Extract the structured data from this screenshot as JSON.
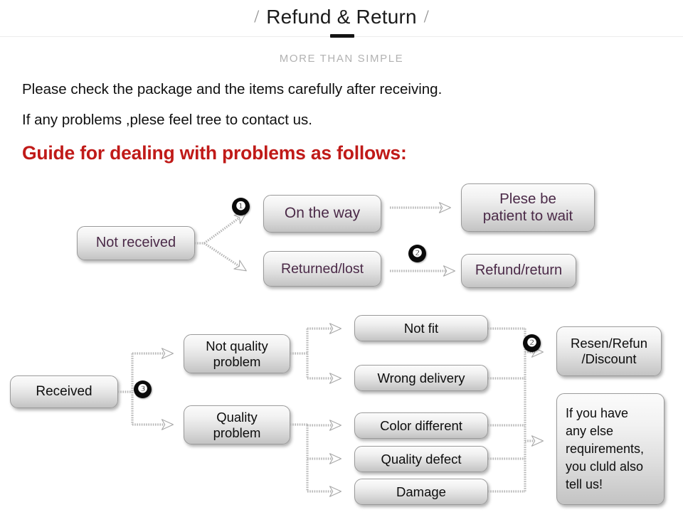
{
  "header": {
    "slash_left": "/",
    "title": "Refund & Return",
    "slash_right": "/",
    "subtitle": "MORE THAN SIMPLE",
    "accent_color": "#141414"
  },
  "intro": {
    "line1": "Please check the package and the items carefully after receiving.",
    "line2": "If any problems ,plese feel tree to contact us.",
    "guide_heading": "Guide for dealing with problems as follows:",
    "guide_color": "#c01a18"
  },
  "flow_not_received": {
    "source": "Not received",
    "badge_1": "❶",
    "badge_2": "❷",
    "branches": [
      {
        "cause": "On the way",
        "outcome": "Plese be\npatient to wait"
      },
      {
        "cause": "Returned/lost",
        "outcome": "Refund/return"
      }
    ]
  },
  "flow_received": {
    "source": "Received",
    "badge_3": "❸",
    "badge_2": "❷",
    "categories": [
      {
        "label": "Not quality\nproblem",
        "issues": [
          "Not fit",
          "Wrong delivery"
        ]
      },
      {
        "label": "Quality\nproblem",
        "issues": [
          "Color different",
          "Quality defect",
          "Damage"
        ]
      }
    ],
    "outcomes": [
      "Resen/Refun\n/Discount",
      "If you have\nany else\nrequirements,\nyou cluld also\ntell us!"
    ]
  },
  "theme": {
    "node_text_purple": "#4b2a48",
    "node_text_dark": "#0d0d0d",
    "node_border": "#9a9a9a",
    "connector": "#b4b4b4"
  }
}
